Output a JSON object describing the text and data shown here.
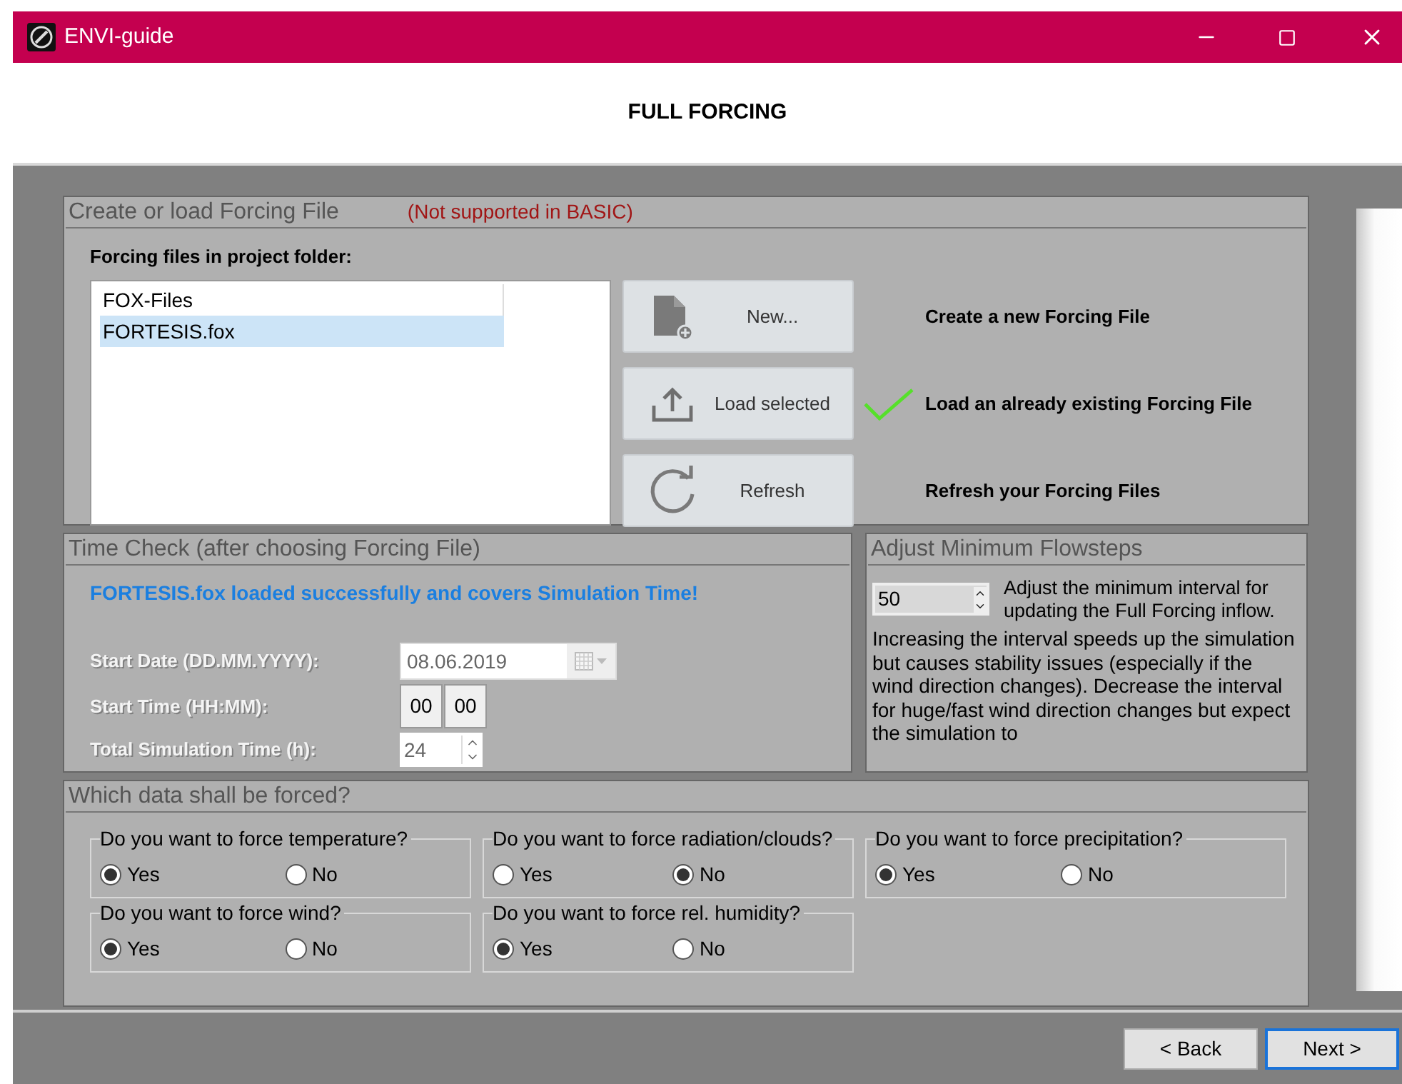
{
  "window": {
    "title": "ENVI-guide"
  },
  "page_title": "FULL FORCING",
  "forcing_file": {
    "title": "Create or load Forcing File",
    "note": "(Not supported in BASIC)",
    "list_label": "Forcing files in project folder:",
    "files": [
      {
        "name": "FOX-Files",
        "selected": false
      },
      {
        "name": "FORTESIS.fox",
        "selected": true
      }
    ],
    "actions": [
      {
        "kind": "new",
        "label": "New...",
        "description": "Create a new Forcing File",
        "done": false
      },
      {
        "kind": "load",
        "label": "Load selected",
        "description": "Load an already existing Forcing File",
        "done": true
      },
      {
        "kind": "refresh",
        "label": "Refresh",
        "description": "Refresh your Forcing Files",
        "done": false
      }
    ]
  },
  "time_check": {
    "title": "Time Check (after choosing Forcing File)",
    "status": "FORTESIS.fox loaded successfully and covers Simulation Time!",
    "fields": [
      {
        "kind": "date",
        "label": "Start Date (DD.MM.YYYY):",
        "value": "08.06.2019",
        "disabled": true
      },
      {
        "kind": "time",
        "label": "Start Time (HH:MM):",
        "hours": "00",
        "minutes": "00",
        "disabled": true
      },
      {
        "kind": "spin",
        "label": "Total Simulation Time (h):",
        "value": "24",
        "disabled": true
      }
    ]
  },
  "flowsteps": {
    "title": "Adjust Minimum Flowsteps",
    "value": "50",
    "hint": "Adjust the minimum interval for updating the Full Forcing inflow.",
    "description": "Increasing the interval speeds up the simulation but causes stability issues (especially if the wind direction changes). Decrease the interval for huge/fast wind direction changes but expect the simulation to"
  },
  "forced": {
    "title": "Which data shall be forced?",
    "groups": [
      {
        "question": "Do you want to force temperature?",
        "options": [
          {
            "label": "Yes",
            "selected": true
          },
          {
            "label": "No",
            "selected": false
          }
        ]
      },
      {
        "question": "Do you want to force radiation/clouds?",
        "options": [
          {
            "label": "Yes",
            "selected": false
          },
          {
            "label": "No",
            "selected": true
          }
        ]
      },
      {
        "question": "Do you want to force precipitation?",
        "options": [
          {
            "label": "Yes",
            "selected": true
          },
          {
            "label": "No",
            "selected": false
          }
        ]
      },
      {
        "question": "Do you want to force wind?",
        "options": [
          {
            "label": "Yes",
            "selected": true
          },
          {
            "label": "No",
            "selected": false
          }
        ]
      },
      {
        "question": "Do you want to force rel. humidity?",
        "options": [
          {
            "label": "Yes",
            "selected": true
          },
          {
            "label": "No",
            "selected": false
          }
        ]
      }
    ]
  },
  "buttons": [
    {
      "label": "< Back",
      "focused": false
    },
    {
      "label": "Next >",
      "focused": true
    }
  ]
}
